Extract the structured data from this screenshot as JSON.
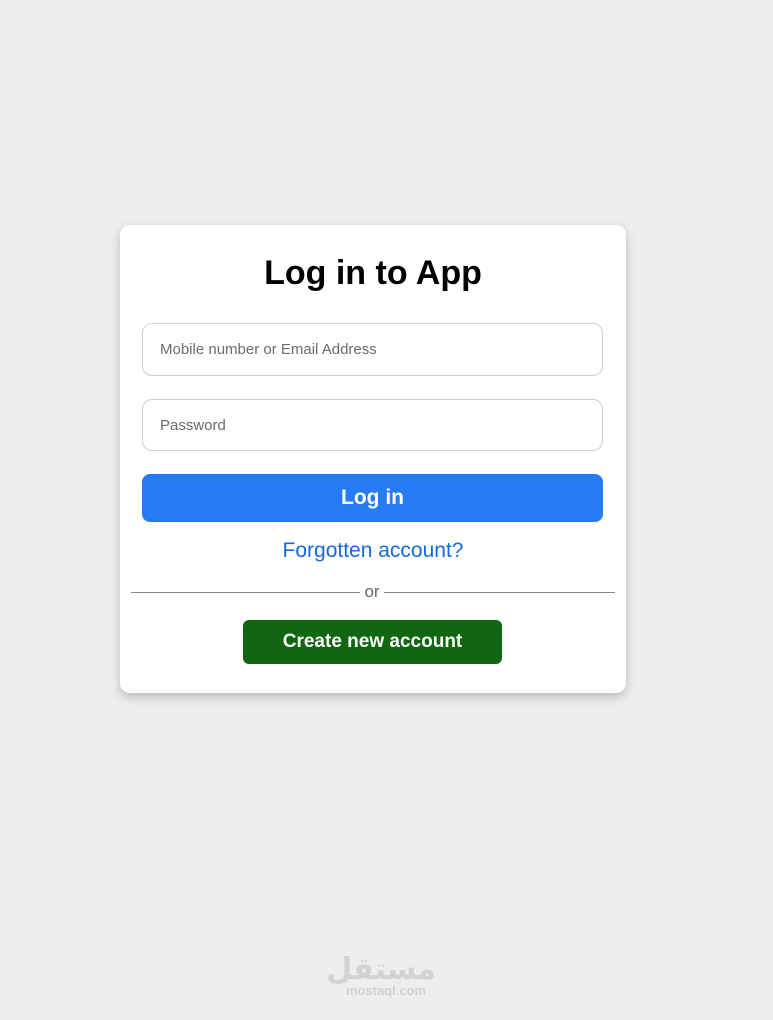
{
  "card": {
    "title": "Log in to App",
    "email_placeholder": "Mobile number or Email Address",
    "email_value": "",
    "password_placeholder": "Password",
    "password_value": "",
    "login_label": "Log in",
    "forgot_label": "Forgotten account?",
    "divider_label": "or",
    "create_label": "Create new account"
  },
  "watermark": {
    "logo_text": "مستقل",
    "site": "mostaql.com"
  },
  "colors": {
    "page_background": "#eeeeee",
    "card_background": "#ffffff",
    "login_button": "#267cf7",
    "forgot_link": "#1569e0",
    "create_button": "#116611",
    "watermark": "#d2d2d2"
  }
}
